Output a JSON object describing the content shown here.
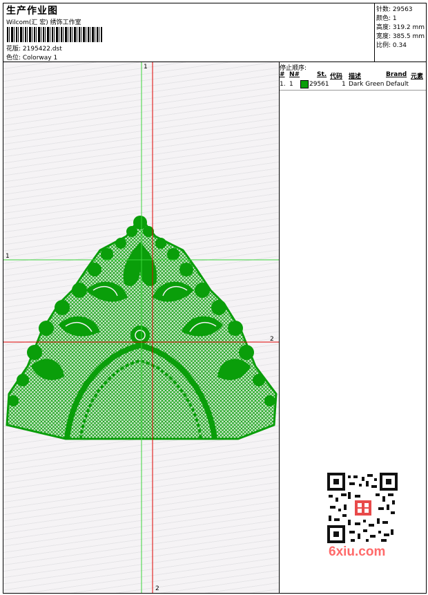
{
  "header": {
    "title": "生产作业图",
    "vendor": "Wilcom(汇 宏) 绣饰工作室",
    "design_label": "花版: 2195422.dst",
    "colorway_label": "色位: Colorway 1"
  },
  "stats": {
    "stitches": "针数: 29563",
    "colors": "颜色: 1",
    "height": "高度: 319.2 mm",
    "width": "宽度: 385.5 mm",
    "scale": "比例: 0.34"
  },
  "stop_sequence": {
    "title": "停止顺序:",
    "headers": [
      "#",
      "N#",
      "St.",
      "代码",
      "描述",
      "Brand",
      "元素"
    ],
    "rows": [
      {
        "idx": "1.",
        "needle": "1",
        "stitches": "29561",
        "code": "1",
        "desc": "Dark Green",
        "brand": "Default",
        "color": "#0a9e0a"
      }
    ]
  },
  "guides": {
    "v_green": "1",
    "h_green": "1",
    "h_red": "2",
    "v_red": "2"
  },
  "watermark": "6xiu.com",
  "colors": {
    "thread": "#0a9e0a",
    "guide_green": "#3bd43b",
    "guide_red": "#e00000"
  }
}
